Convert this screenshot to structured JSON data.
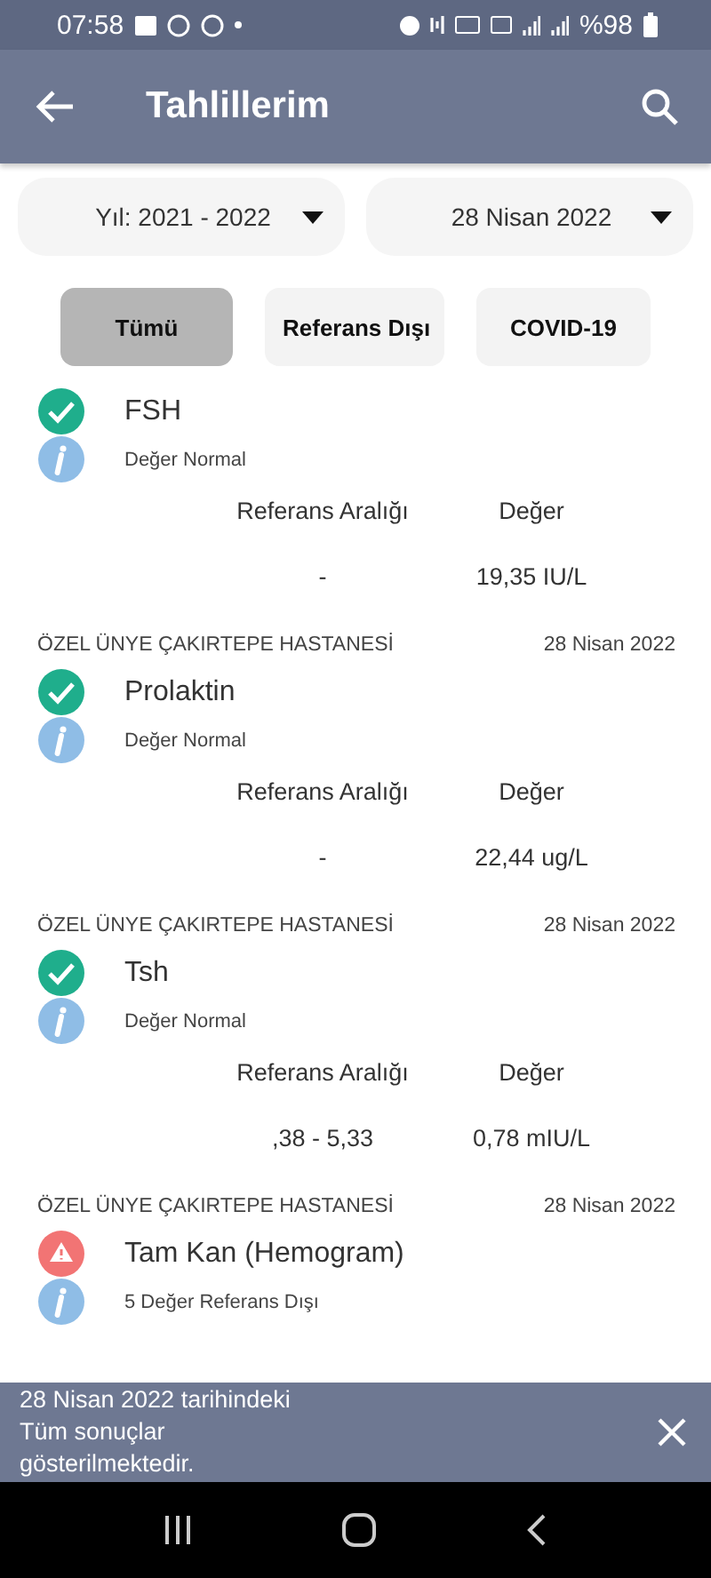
{
  "status_bar": {
    "time": "07:58",
    "battery": "%98"
  },
  "app_bar": {
    "title": "Tahlillerim"
  },
  "filters": [
    {
      "label": "Yıl: 2021 - 2022"
    },
    {
      "label": "28 Nisan 2022"
    }
  ],
  "chips": [
    {
      "label": "Tümü",
      "selected": true
    },
    {
      "label": "Referans Dışı",
      "selected": false
    },
    {
      "label": "COVID-19",
      "selected": false
    }
  ],
  "results": [
    {
      "kind": "normal",
      "name": "FSH",
      "summary": "Değer Normal",
      "range_label": "Referans Aralığı",
      "value_label": "Değer",
      "range": "-",
      "value": "19,35 IU/L"
    },
    {
      "hospital": "ÖZEL ÜNYE ÇAKIRTEPE HASTANESİ",
      "date": "28 Nisan 2022",
      "kind": "normal",
      "name": "Prolaktin",
      "summary": "Değer Normal",
      "range_label": "Referans Aralığı",
      "value_label": "Değer",
      "range": "-",
      "value": "22,44 ug/L"
    },
    {
      "hospital": "ÖZEL ÜNYE ÇAKIRTEPE HASTANESİ",
      "date": "28 Nisan 2022",
      "kind": "normal",
      "name": "Tsh",
      "summary": "Değer Normal",
      "range_label": "Referans Aralığı",
      "value_label": "Değer",
      "range": ",38 - 5,33",
      "value": "0,78 mIU/L"
    },
    {
      "hospital": "ÖZEL ÜNYE ÇAKIRTEPE HASTANESİ",
      "date": "28 Nisan 2022",
      "kind": "warning",
      "name": "Tam Kan (Hemogram)",
      "summary": "5 Değer Referans Dışı"
    }
  ],
  "snackbar": {
    "message": "28 Nisan 2022 tarihindeki Tüm sonuçlar gösterilmektedir."
  }
}
